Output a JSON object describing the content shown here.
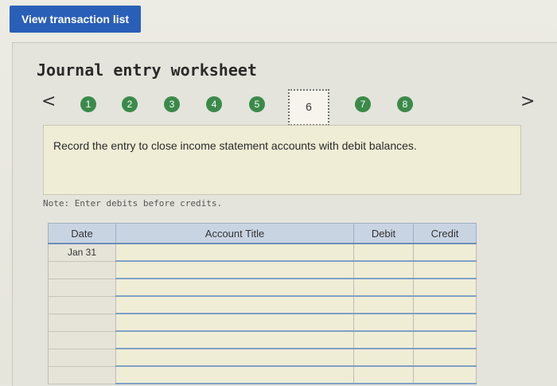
{
  "top_button": {
    "label": "View transaction list"
  },
  "worksheet": {
    "title": "Journal entry worksheet",
    "steps": [
      "1",
      "2",
      "3",
      "4",
      "5",
      "6",
      "7",
      "8"
    ],
    "active_step": "6",
    "prev_icon": "<",
    "next_icon": ">",
    "instruction": "Record the entry to close income statement accounts with debit balances.",
    "note": "Note: Enter debits before credits."
  },
  "table": {
    "headers": {
      "date": "Date",
      "account": "Account Title",
      "debit": "Debit",
      "credit": "Credit"
    },
    "rows": [
      {
        "date": "Jan 31",
        "account": "",
        "debit": "",
        "credit": ""
      },
      {
        "date": "",
        "account": "",
        "debit": "",
        "credit": ""
      },
      {
        "date": "",
        "account": "",
        "debit": "",
        "credit": ""
      },
      {
        "date": "",
        "account": "",
        "debit": "",
        "credit": ""
      },
      {
        "date": "",
        "account": "",
        "debit": "",
        "credit": ""
      },
      {
        "date": "",
        "account": "",
        "debit": "",
        "credit": ""
      },
      {
        "date": "",
        "account": "",
        "debit": "",
        "credit": ""
      },
      {
        "date": "",
        "account": "",
        "debit": "",
        "credit": ""
      }
    ]
  },
  "colors": {
    "button": "#2a5fb8",
    "step": "#3b8a4a",
    "table_header": "#c9d4e3",
    "row_line": "#7fa0c6"
  }
}
